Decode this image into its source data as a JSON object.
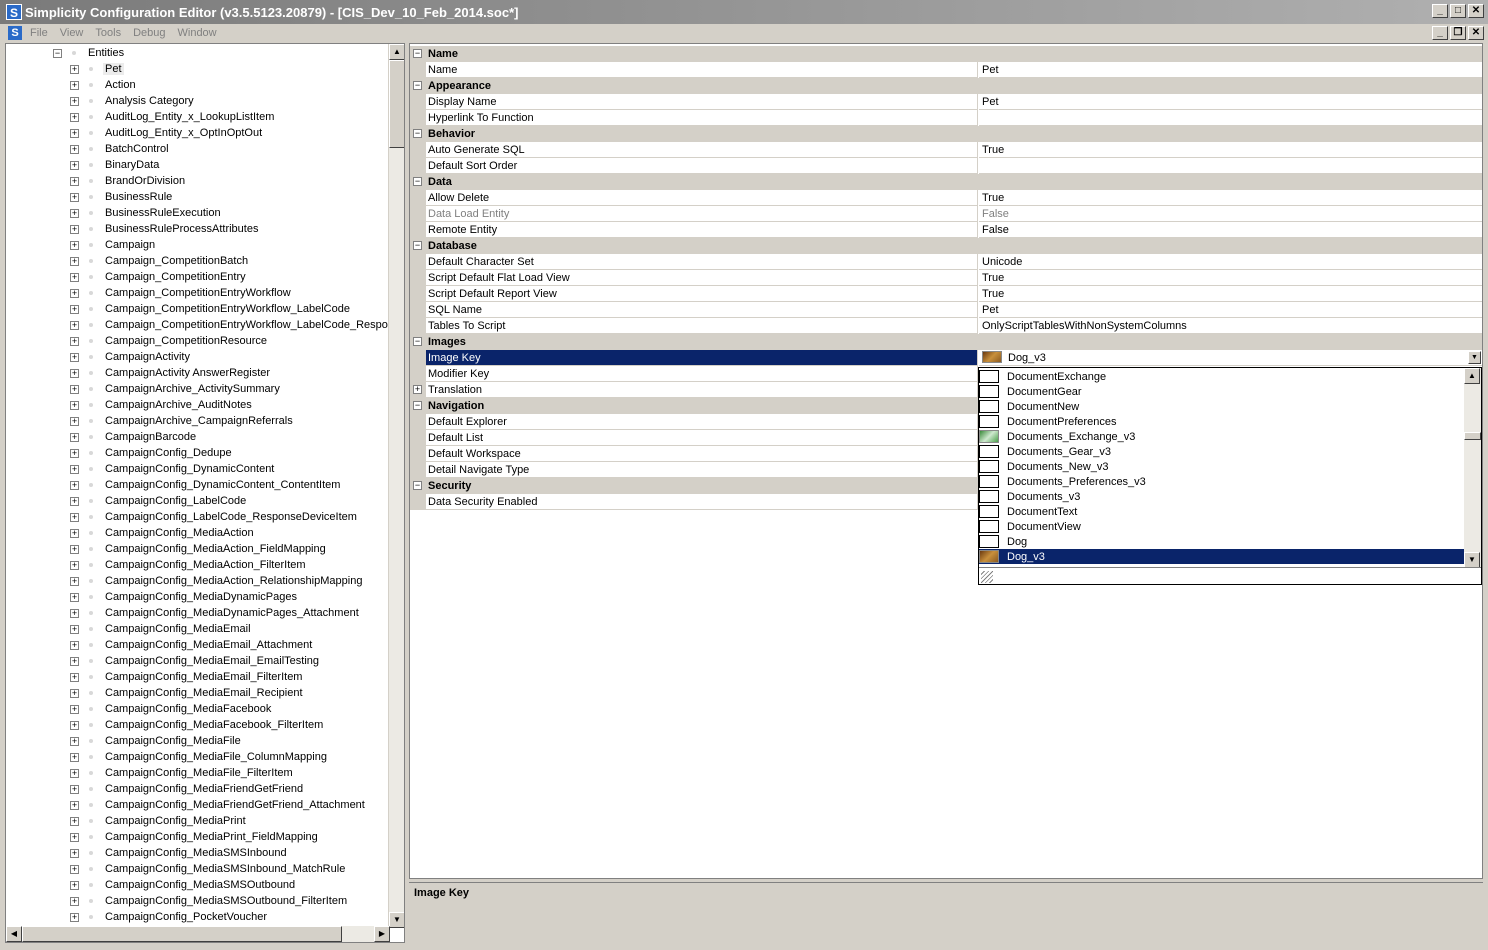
{
  "window": {
    "title": "Simplicity Configuration Editor (v3.5.5123.20879) - [CIS_Dev_10_Feb_2014.soc*]",
    "app_icon": "S",
    "controls": [
      "_",
      "□",
      "✕"
    ]
  },
  "menubar": {
    "items": [
      "File",
      "View",
      "Tools",
      "Debug",
      "Window"
    ],
    "mdi_controls": [
      "_",
      "❐",
      "✕"
    ]
  },
  "tree": {
    "root": "Entities",
    "items": [
      "Pet",
      "Action",
      "Analysis Category",
      "AuditLog_Entity_x_LookupListItem",
      "AuditLog_Entity_x_OptInOptOut",
      "BatchControl",
      "BinaryData",
      "BrandOrDivision",
      "BusinessRule",
      "BusinessRuleExecution",
      "BusinessRuleProcessAttributes",
      "Campaign",
      "Campaign_CompetitionBatch",
      "Campaign_CompetitionEntry",
      "Campaign_CompetitionEntryWorkflow",
      "Campaign_CompetitionEntryWorkflow_LabelCode",
      "Campaign_CompetitionEntryWorkflow_LabelCode_Respons",
      "Campaign_CompetitionResource",
      "CampaignActivity",
      "CampaignActivity AnswerRegister",
      "CampaignArchive_ActivitySummary",
      "CampaignArchive_AuditNotes",
      "CampaignArchive_CampaignReferrals",
      "CampaignBarcode",
      "CampaignConfig_Dedupe",
      "CampaignConfig_DynamicContent",
      "CampaignConfig_DynamicContent_ContentItem",
      "CampaignConfig_LabelCode",
      "CampaignConfig_LabelCode_ResponseDeviceItem",
      "CampaignConfig_MediaAction",
      "CampaignConfig_MediaAction_FieldMapping",
      "CampaignConfig_MediaAction_FilterItem",
      "CampaignConfig_MediaAction_RelationshipMapping",
      "CampaignConfig_MediaDynamicPages",
      "CampaignConfig_MediaDynamicPages_Attachment",
      "CampaignConfig_MediaEmail",
      "CampaignConfig_MediaEmail_Attachment",
      "CampaignConfig_MediaEmail_EmailTesting",
      "CampaignConfig_MediaEmail_FilterItem",
      "CampaignConfig_MediaEmail_Recipient",
      "CampaignConfig_MediaFacebook",
      "CampaignConfig_MediaFacebook_FilterItem",
      "CampaignConfig_MediaFile",
      "CampaignConfig_MediaFile_ColumnMapping",
      "CampaignConfig_MediaFile_FilterItem",
      "CampaignConfig_MediaFriendGetFriend",
      "CampaignConfig_MediaFriendGetFriend_Attachment",
      "CampaignConfig_MediaPrint",
      "CampaignConfig_MediaPrint_FieldMapping",
      "CampaignConfig_MediaSMSInbound",
      "CampaignConfig_MediaSMSInbound_MatchRule",
      "CampaignConfig_MediaSMSOutbound",
      "CampaignConfig_MediaSMSOutbound_FilterItem",
      "CampaignConfig_PocketVoucher"
    ]
  },
  "propgrid": {
    "rows": [
      {
        "kind": "cat",
        "name": "Name"
      },
      {
        "kind": "prop",
        "name": "Name",
        "value": "Pet"
      },
      {
        "kind": "cat",
        "name": "Appearance"
      },
      {
        "kind": "prop",
        "name": "Display Name",
        "value": "Pet"
      },
      {
        "kind": "prop",
        "name": "Hyperlink To Function",
        "value": ""
      },
      {
        "kind": "cat",
        "name": "Behavior"
      },
      {
        "kind": "prop",
        "name": "Auto Generate SQL",
        "value": "True"
      },
      {
        "kind": "prop",
        "name": "Default Sort Order",
        "value": ""
      },
      {
        "kind": "cat",
        "name": "Data"
      },
      {
        "kind": "prop",
        "name": "Allow Delete",
        "value": "True"
      },
      {
        "kind": "prop",
        "name": "Data Load Entity",
        "value": "False",
        "disabled": true
      },
      {
        "kind": "prop",
        "name": "Remote Entity",
        "value": "False"
      },
      {
        "kind": "cat",
        "name": "Database"
      },
      {
        "kind": "prop",
        "name": "Default Character Set",
        "value": "Unicode"
      },
      {
        "kind": "prop",
        "name": "Script Default Flat Load View",
        "value": "True"
      },
      {
        "kind": "prop",
        "name": "Script Default Report View",
        "value": "True"
      },
      {
        "kind": "prop",
        "name": "SQL Name",
        "value": "Pet"
      },
      {
        "kind": "prop",
        "name": "Tables To Script",
        "value": "OnlyScriptTablesWithNonSystemColumns"
      },
      {
        "kind": "cat",
        "name": "Images"
      },
      {
        "kind": "prop",
        "name": "Image Key",
        "value": "Dog_v3",
        "selected": true
      },
      {
        "kind": "prop",
        "name": "Modifier Key",
        "value": ""
      },
      {
        "kind": "prop",
        "name": "Translation",
        "value": "",
        "expandable": true
      },
      {
        "kind": "cat",
        "name": "Navigation"
      },
      {
        "kind": "prop",
        "name": "Default Explorer",
        "value": ""
      },
      {
        "kind": "prop",
        "name": "Default List",
        "value": ""
      },
      {
        "kind": "prop",
        "name": "Default Workspace",
        "value": ""
      },
      {
        "kind": "prop",
        "name": "Detail Navigate Type",
        "value": ""
      },
      {
        "kind": "cat",
        "name": "Security"
      },
      {
        "kind": "prop",
        "name": "Data Security Enabled",
        "value": ""
      }
    ]
  },
  "dropdown": {
    "items": [
      {
        "label": "DocumentExchange",
        "icon": "blank-image-icon"
      },
      {
        "label": "DocumentGear",
        "icon": "blank-image-icon"
      },
      {
        "label": "DocumentNew",
        "icon": "blank-image-icon"
      },
      {
        "label": "DocumentPreferences",
        "icon": "blank-image-icon"
      },
      {
        "label": "Documents_Exchange_v3",
        "icon": "exchange-image-icon"
      },
      {
        "label": "Documents_Gear_v3",
        "icon": "blank-image-icon"
      },
      {
        "label": "Documents_New_v3",
        "icon": "blank-image-icon"
      },
      {
        "label": "Documents_Preferences_v3",
        "icon": "blank-image-icon"
      },
      {
        "label": "Documents_v3",
        "icon": "blank-image-icon"
      },
      {
        "label": "DocumentText",
        "icon": "blank-image-icon"
      },
      {
        "label": "DocumentView",
        "icon": "blank-image-icon"
      },
      {
        "label": "Dog",
        "icon": "blank-image-icon"
      },
      {
        "label": "Dog_v3",
        "icon": "dog-image-icon",
        "selected": true
      }
    ]
  },
  "help": {
    "title": "Image Key"
  }
}
